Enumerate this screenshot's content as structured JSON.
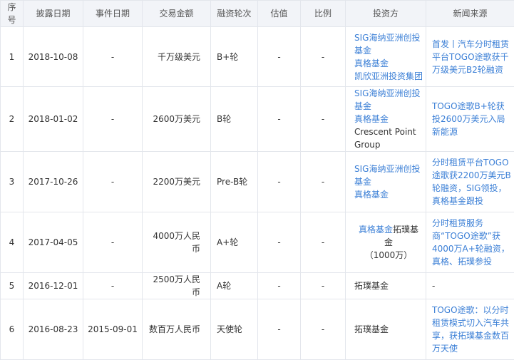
{
  "table": {
    "headers": [
      "序号",
      "披露日期",
      "事件日期",
      "交易金额",
      "融资轮次",
      "估值",
      "比例",
      "投资方",
      "新闻来源"
    ],
    "rows": [
      {
        "seq": "1",
        "disclosure_date": "2018-10-08",
        "event_date": "-",
        "amount": "千万级美元",
        "round": "B+轮",
        "valuation": "-",
        "ratio": "-",
        "investors": [
          {
            "text": "SIG海纳亚洲创投基金",
            "link": true,
            "block": true
          },
          {
            "text": "真格基金",
            "link": true,
            "block": true
          },
          {
            "text": "凯欣亚洲投资集团",
            "link": true,
            "block": true
          }
        ],
        "news": {
          "text": "首发丨汽车分时租赁平台TOGO途歌获千万级美元B2轮融资",
          "link": true
        }
      },
      {
        "seq": "2",
        "disclosure_date": "2018-01-02",
        "event_date": "-",
        "amount": "2600万美元",
        "round": "B轮",
        "valuation": "-",
        "ratio": "-",
        "investors": [
          {
            "text": "SIG海纳亚洲创投基金",
            "link": true,
            "block": true
          },
          {
            "text": "真格基金",
            "link": true,
            "block": false
          },
          {
            "text": "Crescent Point Group",
            "link": false,
            "block": false
          }
        ],
        "news": {
          "text": "TOGO途歌B+轮获投2600万美元入局新能源",
          "link": true
        }
      },
      {
        "seq": "3",
        "disclosure_date": "2017-10-26",
        "event_date": "-",
        "amount": "2200万美元",
        "round": "Pre-B轮",
        "valuation": "-",
        "ratio": "-",
        "investors": [
          {
            "text": "SIG海纳亚洲创投基金",
            "link": true,
            "block": true
          },
          {
            "text": "真格基金",
            "link": true,
            "block": true
          }
        ],
        "news": {
          "text": "分时租赁平台TOGO途歌获2200万美元B轮融资，SIG领投，真格基金跟投",
          "link": true
        }
      },
      {
        "seq": "4",
        "disclosure_date": "2017-04-05",
        "event_date": "-",
        "amount": "4000万人民币",
        "round": "A+轮",
        "valuation": "-",
        "ratio": "-",
        "investors_centered": true,
        "investors": [
          {
            "text": "真格基金",
            "link": true,
            "block": false
          },
          {
            "text": "拓璞基金",
            "link": false,
            "block": false
          },
          {
            "text": "（1000万）",
            "link": false,
            "block": true
          }
        ],
        "news": {
          "text": "分时租赁服务商“TOGO途歌”获4000万A+轮融资，真格、拓璞参投",
          "link": true
        }
      },
      {
        "seq": "5",
        "disclosure_date": "2016-12-01",
        "event_date": "-",
        "amount": "2500万人民币",
        "round": "A轮",
        "valuation": "-",
        "ratio": "-",
        "investors": [
          {
            "text": "拓璞基金",
            "link": false,
            "block": true
          }
        ],
        "news": {
          "text": "-",
          "link": false
        }
      },
      {
        "seq": "6",
        "disclosure_date": "2016-08-23",
        "event_date": "2015-09-01",
        "amount": "数百万人民币",
        "round": "天使轮",
        "valuation": "-",
        "ratio": "-",
        "investors": [
          {
            "text": "拓璞基金",
            "link": false,
            "block": true
          }
        ],
        "news": {
          "text": "TOGO途歌：以分时租赁模式切入汽车共享，获拓璞基金数百万天使",
          "link": true
        }
      }
    ]
  }
}
